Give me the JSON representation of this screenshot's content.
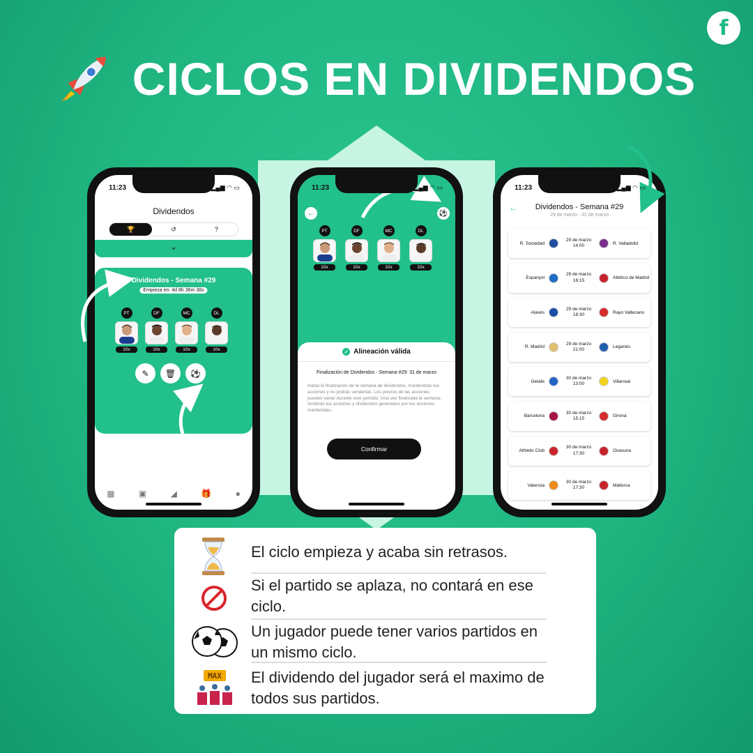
{
  "title": "CICLOS EN DIVIDENDOS",
  "logo": "f",
  "status_time": "11:23",
  "phone1": {
    "title": "Dividendos",
    "card_title": "Dividendos - Semana #29",
    "starts_in": "Empieza en: 4d 8h 36m 38s",
    "players": [
      {
        "pos": "PT",
        "mult": "10x"
      },
      {
        "pos": "DF",
        "mult": "10x"
      },
      {
        "pos": "MC",
        "mult": "10x"
      },
      {
        "pos": "DL",
        "mult": "10x"
      }
    ]
  },
  "phone2": {
    "players": [
      {
        "pos": "PT",
        "mult": "10x"
      },
      {
        "pos": "DF",
        "mult": "10x"
      },
      {
        "pos": "MC",
        "mult": "10x"
      },
      {
        "pos": "DL",
        "mult": "10x"
      }
    ],
    "sheet_title": "Alineación válida",
    "finalization": "Finalización de Dividendos - Semana #29: 31 de marzo",
    "description": "Hasta la finalización de la semana de dividendos, mantendrás tus acciones y no podrás venderlas. Los precios de las acciones pueden variar durante este periodo. Una vez finalizada la semana, recibirás tus acciones y dividendos generados por tus acciones mantenidas.",
    "confirm": "Confirmar"
  },
  "phone3": {
    "title": "Dividendos - Semana #29",
    "subtitle": "29 de marzo - 31 de marzo",
    "matches": [
      {
        "home": "R. Sociedad",
        "date": "29 de marzo",
        "time": "14:00",
        "away": "R. Valladolid",
        "hc": "#1f4fa0",
        "ac": "#7a2f8c"
      },
      {
        "home": "Espanyol",
        "date": "29 de marzo",
        "time": "16:15",
        "away": "Atlético de Madrid",
        "hc": "#1e6cc4",
        "ac": "#c8232c"
      },
      {
        "home": "Alavés",
        "date": "29 de marzo",
        "time": "18:30",
        "away": "Rayo Vallecano",
        "hc": "#1d4fa8",
        "ac": "#d42c2c"
      },
      {
        "home": "R. Madrid",
        "date": "29 de marzo",
        "time": "21:00",
        "away": "Leganés",
        "hc": "#e0c070",
        "ac": "#1e5fb0"
      },
      {
        "home": "Getafe",
        "date": "30 de marzo",
        "time": "13:00",
        "away": "Villarreal",
        "hc": "#2266c8",
        "ac": "#f2d21b"
      },
      {
        "home": "Barcelona",
        "date": "30 de marzo",
        "time": "15:15",
        "away": "Girona",
        "hc": "#a5144a",
        "ac": "#d42c2c"
      },
      {
        "home": "Athletic Club",
        "date": "30 de marzo",
        "time": "17:30",
        "away": "Osasuna",
        "hc": "#c8232c",
        "ac": "#c8232c"
      },
      {
        "home": "Valencia",
        "date": "30 de marzo",
        "time": "17:30",
        "away": "Mallorca",
        "hc": "#f08a1c",
        "ac": "#c8232c"
      }
    ]
  },
  "info": [
    {
      "icon": "hourglass-icon",
      "text": "El ciclo empieza y acaba sin retrasos."
    },
    {
      "icon": "prohibited-icon",
      "text": "Si el partido se aplaza, no contará en ese ciclo."
    },
    {
      "icon": "soccer-balls-icon",
      "text": "Un jugador puede tener varios partidos en un mismo ciclo."
    },
    {
      "icon": "max-podium-icon",
      "text": "El dividendo del jugador será el maximo de todos sus partidos."
    }
  ],
  "max_label": "MAX",
  "colors": {
    "brand": "#22c08a",
    "dark": "#111111"
  }
}
